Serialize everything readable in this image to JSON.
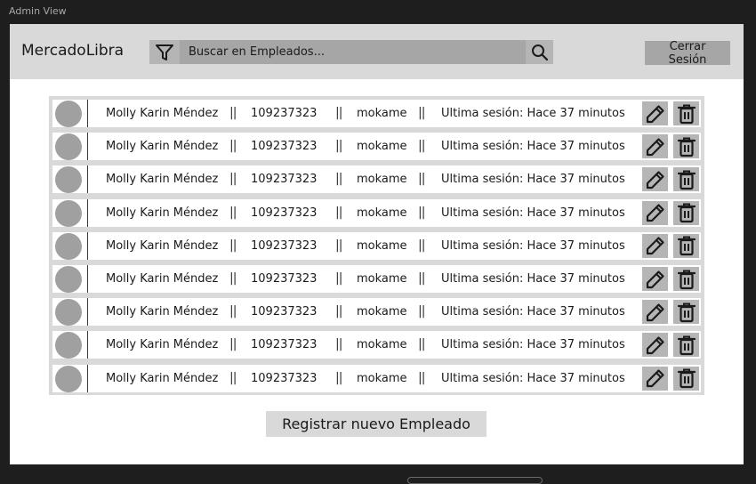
{
  "frame": {
    "label": "Admin View"
  },
  "header": {
    "brand": "MercadoLibra",
    "filter_icon": "filter-icon",
    "search": {
      "placeholder": "Buscar en Empleados...",
      "value": ""
    },
    "search_icon": "search-icon",
    "logout_label": "Cerrar Sesión"
  },
  "employees": {
    "separator": "||",
    "rows": [
      {
        "name": "Molly Karin Méndez",
        "id": "109237323",
        "username": "mokame",
        "last_session": "Ultima sesión: Hace 37 minutos"
      },
      {
        "name": "Molly Karin Méndez",
        "id": "109237323",
        "username": "mokame",
        "last_session": "Ultima sesión: Hace 37 minutos"
      },
      {
        "name": "Molly Karin Méndez",
        "id": "109237323",
        "username": "mokame",
        "last_session": "Ultima sesión: Hace 37 minutos"
      },
      {
        "name": "Molly Karin Méndez",
        "id": "109237323",
        "username": "mokame",
        "last_session": "Ultima sesión: Hace 37 minutos"
      },
      {
        "name": "Molly Karin Méndez",
        "id": "109237323",
        "username": "mokame",
        "last_session": "Ultima sesión: Hace 37 minutos"
      },
      {
        "name": "Molly Karin Méndez",
        "id": "109237323",
        "username": "mokame",
        "last_session": "Ultima sesión: Hace 37 minutos"
      },
      {
        "name": "Molly Karin Méndez",
        "id": "109237323",
        "username": "mokame",
        "last_session": "Ultima sesión: Hace 37 minutos"
      },
      {
        "name": "Molly Karin Méndez",
        "id": "109237323",
        "username": "mokame",
        "last_session": "Ultima sesión: Hace 37 minutos"
      },
      {
        "name": "Molly Karin Méndez",
        "id": "109237323",
        "username": "mokame",
        "last_session": "Ultima sesión: Hace 37 minutos"
      }
    ],
    "row_icons": [
      "avatar",
      "pencil-icon",
      "trash-icon"
    ]
  },
  "footer": {
    "register_label": "Registrar nuevo Empleado"
  },
  "colors": {
    "background": "#1e1e1e",
    "header": "#d9d9d9",
    "search": "#a6a6a6",
    "avatar": "#a0a0a0"
  }
}
